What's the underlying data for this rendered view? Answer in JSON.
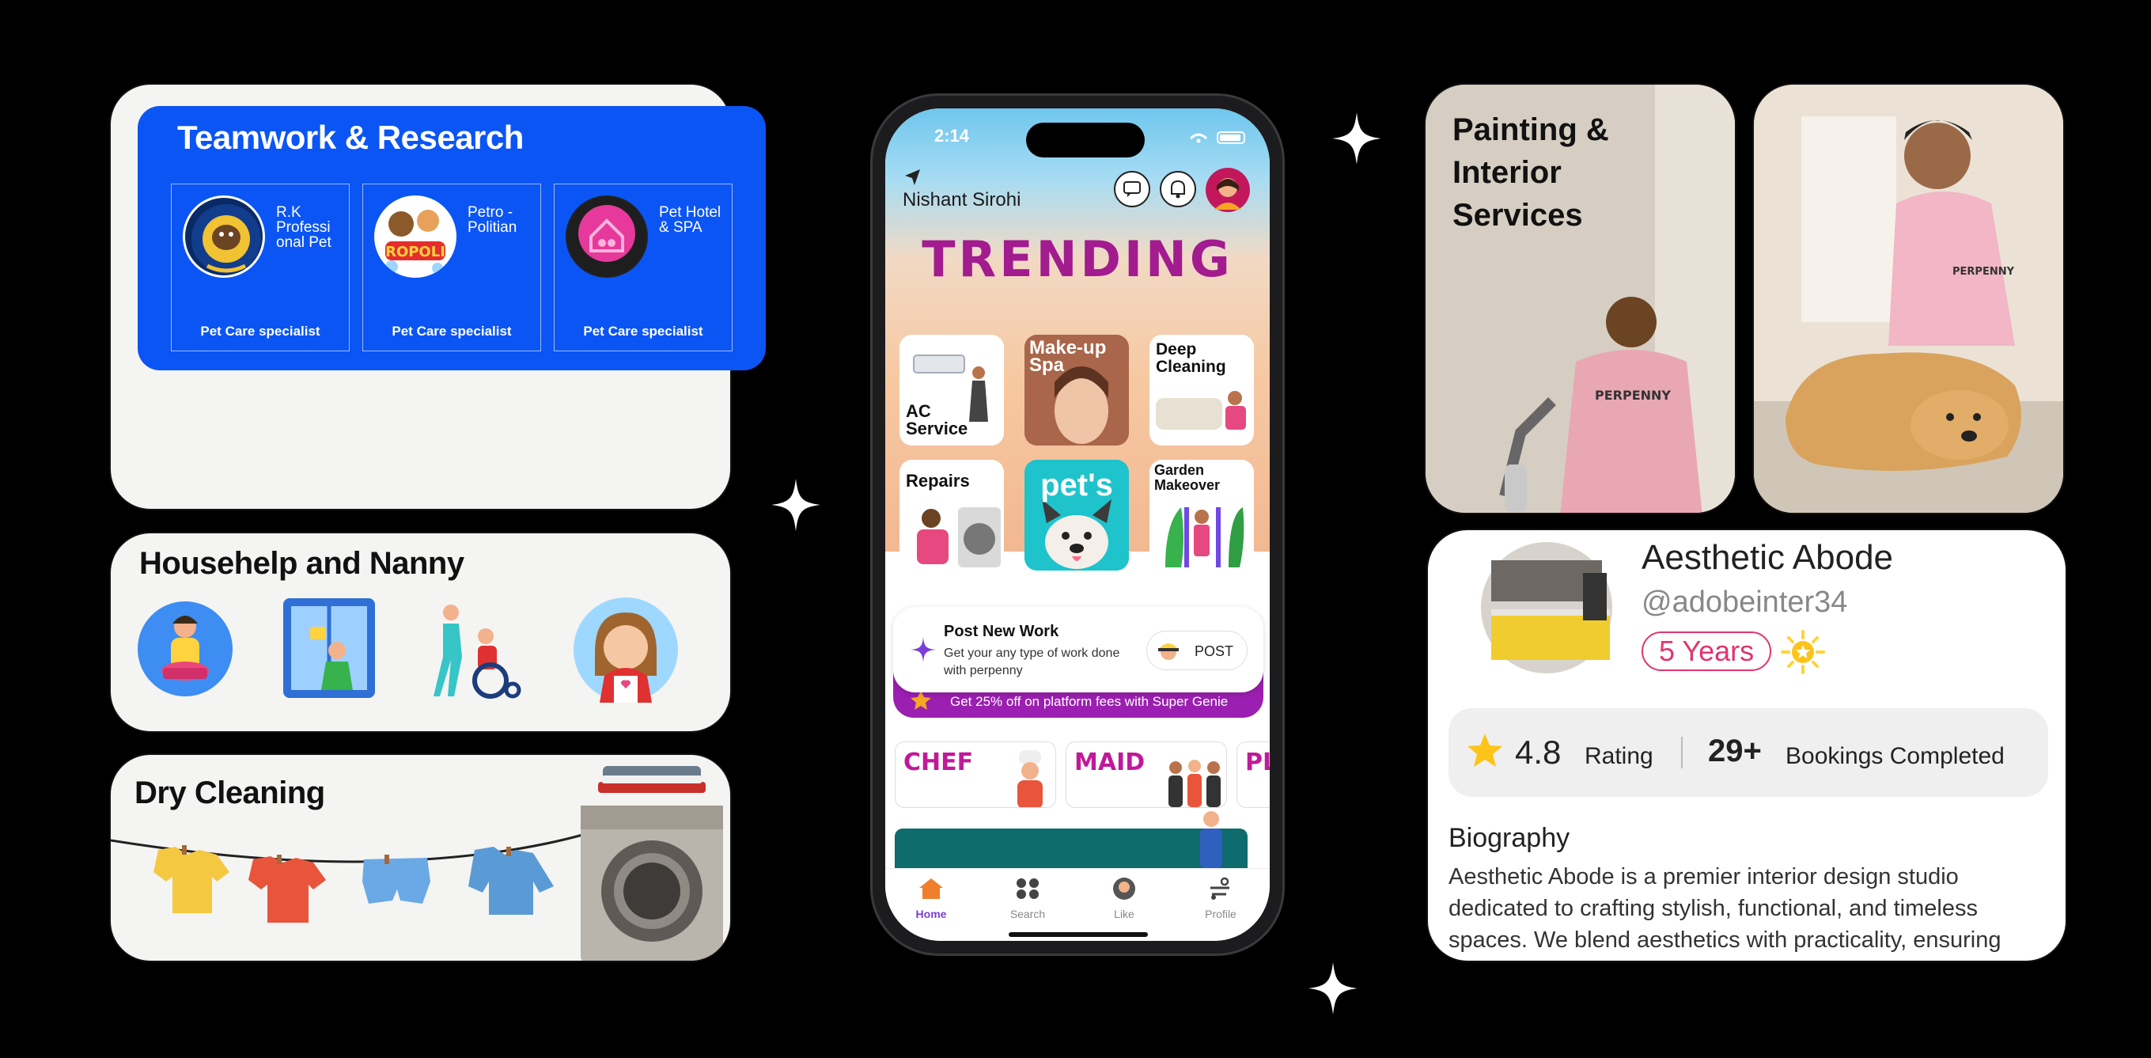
{
  "team": {
    "title": "Teamwork & Research",
    "partners": [
      {
        "name": "R.K Professi onal Pet",
        "label": "Pet Care specialist",
        "logo_text": "R.K PROFESSIONAL PET SHOP"
      },
      {
        "name": "Petro - Politian",
        "label": "Pet Care specialist",
        "logo_text": "ROPOLI"
      },
      {
        "name": "Pet Hotel & SPA",
        "label": "Pet Care specialist"
      }
    ]
  },
  "househelp": {
    "title": "Househelp and Nanny"
  },
  "dry": {
    "title": "Dry Cleaning"
  },
  "phone": {
    "time": "2:14",
    "user": "Nishant Sirohi",
    "banner": "TRENDING",
    "tiles": [
      {
        "label": "AC Service"
      },
      {
        "label": "Make-up Spa"
      },
      {
        "label": "Deep Cleaning"
      },
      {
        "label": "Repairs"
      },
      {
        "label": "pet's"
      },
      {
        "label": "Garden Makeover"
      }
    ],
    "post": {
      "title": "Post New Work",
      "desc": "Get your any type of work done with perpenny",
      "button": "POST"
    },
    "promo": "Get 25% off on platform fees with Super Genie",
    "categories": [
      {
        "label": "CHEF"
      },
      {
        "label": "MAID"
      },
      {
        "label": "PL"
      }
    ],
    "tabs": [
      {
        "label": "Home"
      },
      {
        "label": "Search"
      },
      {
        "label": "Like"
      },
      {
        "label": "Profile"
      }
    ],
    "colors": {
      "accent": "#7b3fd6",
      "brand": "#a21b8f",
      "promo": "#9b1fb0"
    }
  },
  "painting": {
    "title": "Painting & Interior Services",
    "shirt_text": "PERPENNY"
  },
  "groomer": {
    "shirt_text": "PERPENNY"
  },
  "profile": {
    "name": "Aesthetic Abode",
    "handle": "@adobeinter34",
    "years": "5 Years",
    "rating": "4.8",
    "rating_label": "Rating",
    "bookings": "29+",
    "bookings_label": "Bookings Completed",
    "bio_heading": "Biography",
    "bio": "Aesthetic Abode is a premier interior design studio dedicated to crafting stylish, functional, and timeless spaces. We blend aesthetics with practicality, ensuring"
  }
}
